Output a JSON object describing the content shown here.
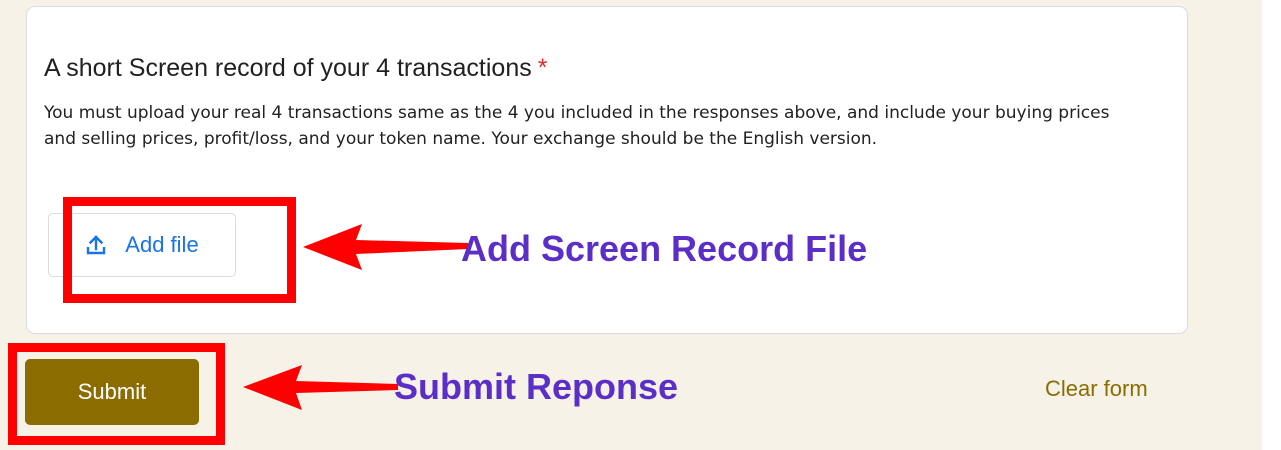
{
  "question": {
    "title": "A short Screen record of your 4 transactions",
    "required_marker": "*",
    "description": "You must upload your real 4 transactions same as the 4 you included in the responses above, and include your buying prices and selling prices, profit/loss, and your token name. Your exchange should be the English version.",
    "add_file_label": "Add file",
    "add_file_icon": "upload-icon"
  },
  "form": {
    "submit_label": "Submit",
    "clear_label": "Clear form"
  },
  "annotations": {
    "add_file_note": "Add Screen Record File",
    "submit_note": "Submit Reponse"
  },
  "colors": {
    "page_background": "#f6f2e8",
    "accent": "#8b6c00",
    "link_blue": "#1a73e8",
    "required": "#d93025",
    "highlight_red": "#ff0000",
    "annotation_purple": "#5b2fc7"
  }
}
